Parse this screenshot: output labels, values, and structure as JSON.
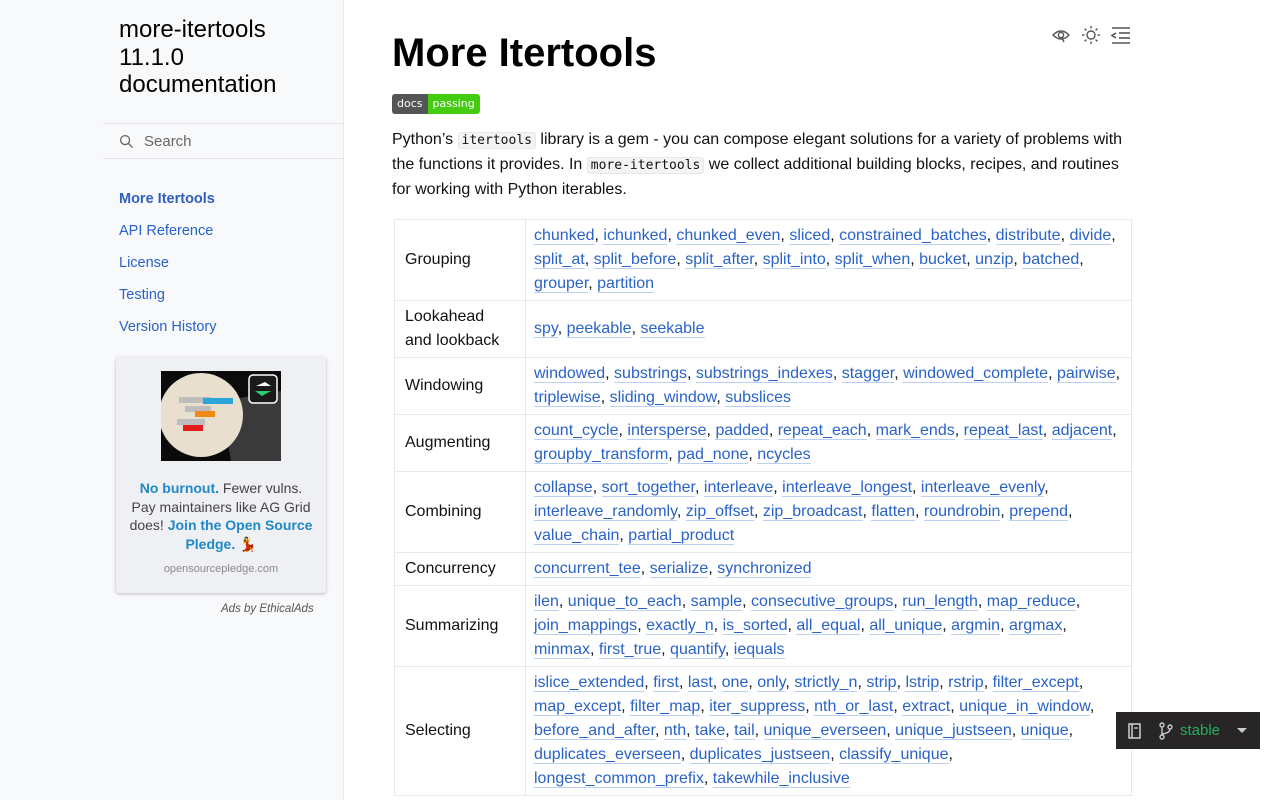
{
  "sidebar": {
    "brand": "more-itertools 11.1.0 documentation",
    "search_placeholder": "Search",
    "nav": [
      {
        "label": "More Itertools",
        "current": true
      },
      {
        "label": "API Reference"
      },
      {
        "label": "License"
      },
      {
        "label": "Testing"
      },
      {
        "label": "Version History"
      }
    ],
    "ad": {
      "headline": "No burnout.",
      "text1": " Fewer vulns. Pay maintainers like AG Grid does! ",
      "cta": "Join the Open Source Pledge.",
      "emoji": "💃",
      "domain": "opensourcepledge.com",
      "footer": "Ads by EthicalAds"
    }
  },
  "main": {
    "title": "More Itertools",
    "badge": {
      "left": "docs",
      "right": "passing"
    },
    "intro": {
      "p1": "Python’s ",
      "code1": "itertools",
      "p2": " library is a gem - you can compose elegant solutions for a variety of problems with the functions it provides. In ",
      "code2": "more-itertools",
      "p3": " we collect additional building blocks, recipes, and routines for working with Python iterables."
    },
    "table": [
      {
        "category": "Grouping",
        "functions": [
          "chunked",
          "ichunked",
          "chunked_even",
          "sliced",
          "constrained_batches",
          "distribute",
          "divide",
          "split_at",
          "split_before",
          "split_after",
          "split_into",
          "split_when",
          "bucket",
          "unzip",
          "batched",
          "grouper",
          "partition"
        ]
      },
      {
        "category": "Lookahead and lookback",
        "functions": [
          "spy",
          "peekable",
          "seekable"
        ]
      },
      {
        "category": "Windowing",
        "functions": [
          "windowed",
          "substrings",
          "substrings_indexes",
          "stagger",
          "windowed_complete",
          "pairwise",
          "triplewise",
          "sliding_window",
          "subslices"
        ]
      },
      {
        "category": "Augmenting",
        "functions": [
          "count_cycle",
          "intersperse",
          "padded",
          "repeat_each",
          "mark_ends",
          "repeat_last",
          "adjacent",
          "groupby_transform",
          "pad_none",
          "ncycles"
        ]
      },
      {
        "category": "Combining",
        "functions": [
          "collapse",
          "sort_together",
          "interleave",
          "interleave_longest",
          "interleave_evenly",
          "interleave_randomly",
          "zip_offset",
          "zip_broadcast",
          "flatten",
          "roundrobin",
          "prepend",
          "value_chain",
          "partial_product"
        ]
      },
      {
        "category": "Concurrency",
        "functions": [
          "concurrent_tee",
          "serialize",
          "synchronized"
        ]
      },
      {
        "category": "Summarizing",
        "functions": [
          "ilen",
          "unique_to_each",
          "sample",
          "consecutive_groups",
          "run_length",
          "map_reduce",
          "join_mappings",
          "exactly_n",
          "is_sorted",
          "all_equal",
          "all_unique",
          "argmin",
          "argmax",
          "minmax",
          "first_true",
          "quantify",
          "iequals"
        ]
      },
      {
        "category": "Selecting",
        "functions": [
          "islice_extended",
          "first",
          "last",
          "one",
          "only",
          "strictly_n",
          "strip",
          "lstrip",
          "rstrip",
          "filter_except",
          "map_except",
          "filter_map",
          "iter_suppress",
          "nth_or_last",
          "extract",
          "unique_in_window",
          "before_and_after",
          "nth",
          "take",
          "tail",
          "unique_everseen",
          "unique_justseen",
          "unique",
          "duplicates_everseen",
          "duplicates_justseen",
          "classify_unique",
          "longest_common_prefix",
          "takewhile_inclusive"
        ]
      }
    ]
  },
  "flyout": {
    "version": "stable"
  },
  "icons": {
    "toolbar": [
      "view-source-icon",
      "theme-toggle-icon",
      "toc-toggle-icon"
    ]
  }
}
